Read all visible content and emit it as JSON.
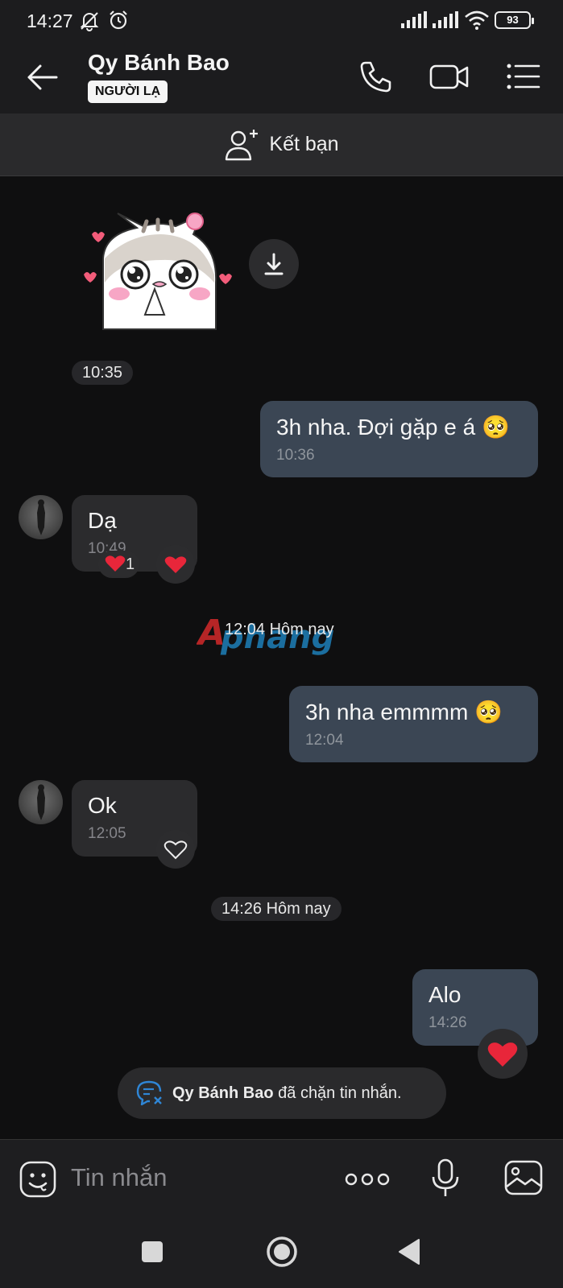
{
  "status_bar": {
    "time": "14:27",
    "battery": "93"
  },
  "header": {
    "contact_name": "Qy Bánh Bao",
    "badge": "NGƯỜI LẠ"
  },
  "add_friend": {
    "label": "Kết bạn"
  },
  "messages": [
    {
      "type": "sticker"
    },
    {
      "type": "time",
      "text": "10:35"
    },
    {
      "type": "out",
      "text": "3h nha. Đợi gặp e á 🥺",
      "time": "10:36"
    },
    {
      "type": "in",
      "text": "Dạ",
      "time": "10:49",
      "reaction_count": "1"
    },
    {
      "type": "time",
      "text": "12:04 Hôm nay"
    },
    {
      "type": "out",
      "text": "3h nha emmmm 🥺",
      "time": "12:04"
    },
    {
      "type": "in",
      "text": "Ok",
      "time": "12:05"
    },
    {
      "type": "time",
      "text": "14:26 Hôm nay"
    },
    {
      "type": "out",
      "text": "Alo",
      "time": "14:26"
    }
  ],
  "watermark": "Aphang",
  "blocked_notice": {
    "name": "Qy Bánh Bao",
    "text": " đã chặn tin nhắn."
  },
  "input": {
    "placeholder": "Tin nhắn"
  },
  "colors": {
    "bubble_out": "#3b4654",
    "bubble_in": "#2b2b2d",
    "background": "#0f0f10",
    "heart": "#e8263a"
  },
  "icons": [
    "back-arrow-icon",
    "phone-icon",
    "video-icon",
    "menu-list-icon",
    "add-user-icon",
    "download-icon",
    "heart-icon",
    "heart-outline-icon",
    "emoji-icon",
    "more-dots-icon",
    "mic-icon",
    "image-icon",
    "recents-icon",
    "home-icon",
    "back-triangle-icon",
    "blocked-chat-icon"
  ]
}
